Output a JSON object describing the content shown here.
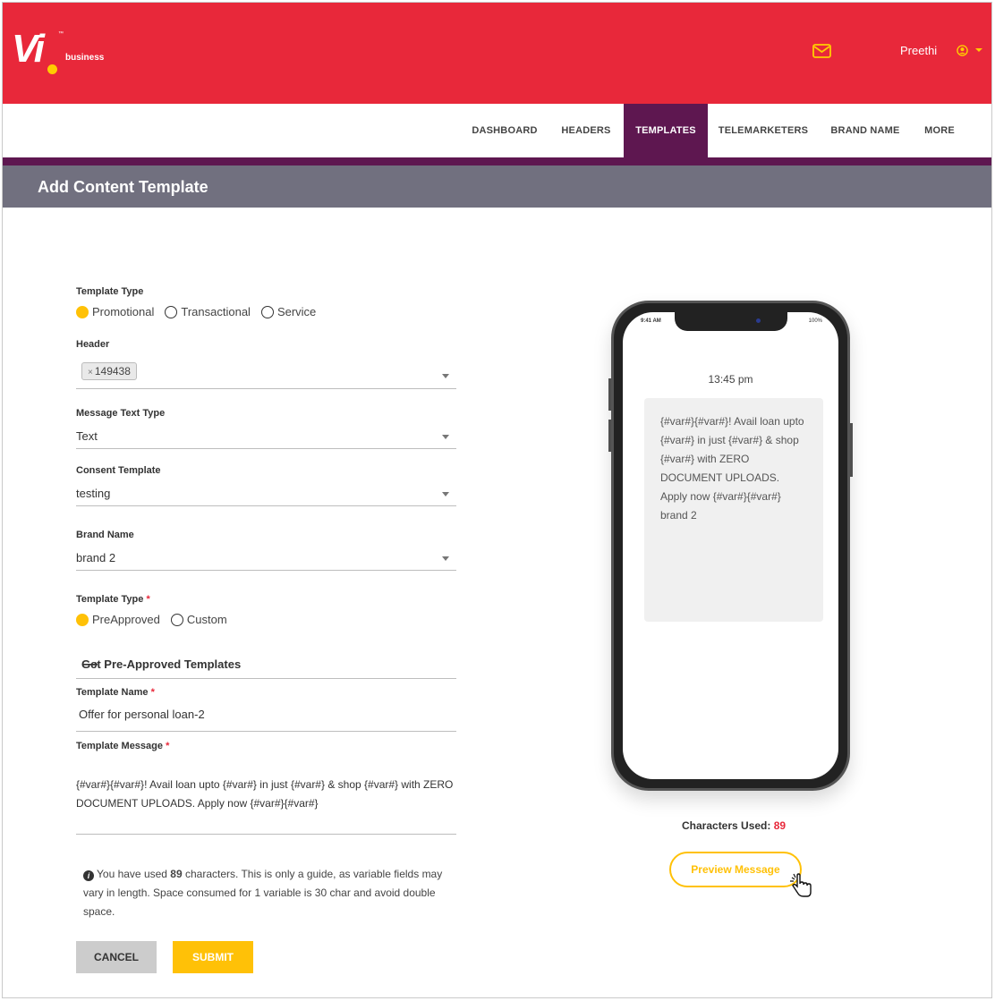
{
  "brand": {
    "logo_text": "Vi",
    "logo_sub": "business",
    "tm": "™"
  },
  "user": {
    "name": "Preethi"
  },
  "nav": {
    "items": [
      {
        "label": "DASHBOARD",
        "active": false
      },
      {
        "label": "HEADERS",
        "active": false
      },
      {
        "label": "TEMPLATES",
        "active": true
      },
      {
        "label": "TELEMARKETERS",
        "active": false
      },
      {
        "label": "BRAND NAME",
        "active": false
      },
      {
        "label": "MORE",
        "active": false
      }
    ]
  },
  "page": {
    "title": "Add Content Template"
  },
  "form": {
    "template_type_label": "Template Type",
    "template_type_options": [
      "Promotional",
      "Transactional",
      "Service"
    ],
    "template_type_selected": "Promotional",
    "header_label": "Header",
    "header_chip": "149438",
    "header_chip_remove": "×",
    "message_text_type_label": "Message Text Type",
    "message_text_type_value": "Text",
    "consent_template_label": "Consent Template",
    "consent_template_value": "testing",
    "brand_name_label": "Brand Name",
    "brand_name_value": "brand 2",
    "template_type2_label": "Template Type",
    "required_mark": "*",
    "template_type2_options": [
      "PreApproved",
      "Custom"
    ],
    "template_type2_selected": "PreApproved",
    "preapproved_link": "Get Pre-Approved Templates",
    "arrow": "⟶",
    "template_name_label": "Template Name",
    "template_name_value": "Offer for personal loan-2",
    "template_message_label": "Template Message",
    "template_message_value": "{#var#}{#var#}! Avail loan upto {#var#} in just {#var#} & shop {#var#} with ZERO DOCUMENT UPLOADS. Apply now {#var#}{#var#}",
    "info_prefix": "You have used ",
    "info_count": "89",
    "info_suffix": " characters. This is only a guide, as variable fields may vary in length. Space consumed for 1 variable is 30 char and avoid double space.",
    "cancel_label": "CANCEL",
    "submit_label": "SUBMIT"
  },
  "preview": {
    "status_time": "9:41 AM",
    "status_battery": "100%",
    "time": "13:45 pm",
    "message": "{#var#}{#var#}! Avail loan upto {#var#} in just {#var#} & shop {#var#} with ZERO DOCUMENT UPLOADS. Apply now {#var#}{#var#} brand 2",
    "chars_label": "Characters Used: ",
    "chars_count": "89",
    "preview_button": "Preview Message"
  },
  "colors": {
    "brand_red": "#e8283a",
    "accent_yellow": "#ffc107",
    "nav_purple": "#5e1750",
    "title_gray": "#71707f"
  }
}
